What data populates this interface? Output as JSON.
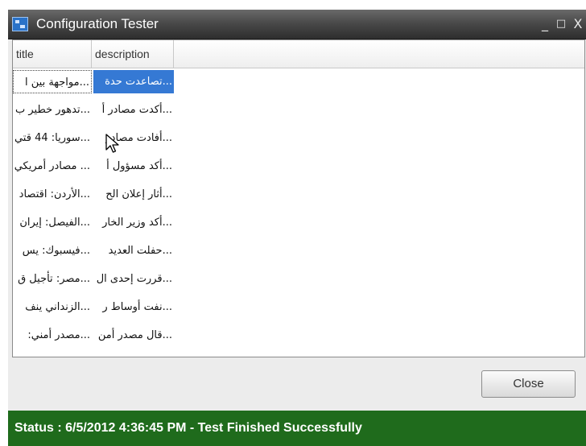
{
  "window": {
    "title": "Configuration Tester",
    "controls": {
      "minimize": "_",
      "maximize": "□",
      "close": "X"
    },
    "icon": "app-window-icon"
  },
  "grid": {
    "columns": [
      "title",
      "description"
    ],
    "rows": [
      {
        "title": "...مواجهة بين ا",
        "description": "...تصاعدت حدة",
        "selected": true
      },
      {
        "title": "...تدهور خطير ب",
        "description": "...أكدت مصادر أ"
      },
      {
        "title": "...سوريا: 44 قتي",
        "description": "...أفادت مصادر"
      },
      {
        "title": "... مصادر أمريكي",
        "description": "...أكد مسؤول أ"
      },
      {
        "title": "...الأردن: اقتصاد",
        "description": "...أثار إعلان الح"
      },
      {
        "title": "...الفيصل: إيران",
        "description": "...أكد وزير الخار"
      },
      {
        "title": "...فيسبوك: يس",
        "description": "...حفلت العديد"
      },
      {
        "title": "...مصر: تأجيل ق",
        "description": "...قررت إحدى ال"
      },
      {
        "title": "...الزنداني ينف",
        "description": "...نفت أوساط ر"
      },
      {
        "title": "...مصدر أمني:",
        "description": "...قال مصدر أمن"
      }
    ]
  },
  "buttons": {
    "close": "Close"
  },
  "status": {
    "text": "Status : 6/5/2012 4:36:45 PM - Test Finished Successfully"
  },
  "colors": {
    "statusbar": "#1f6b1c",
    "selection": "#3579d4",
    "titlebar": "#3a3a3a"
  }
}
